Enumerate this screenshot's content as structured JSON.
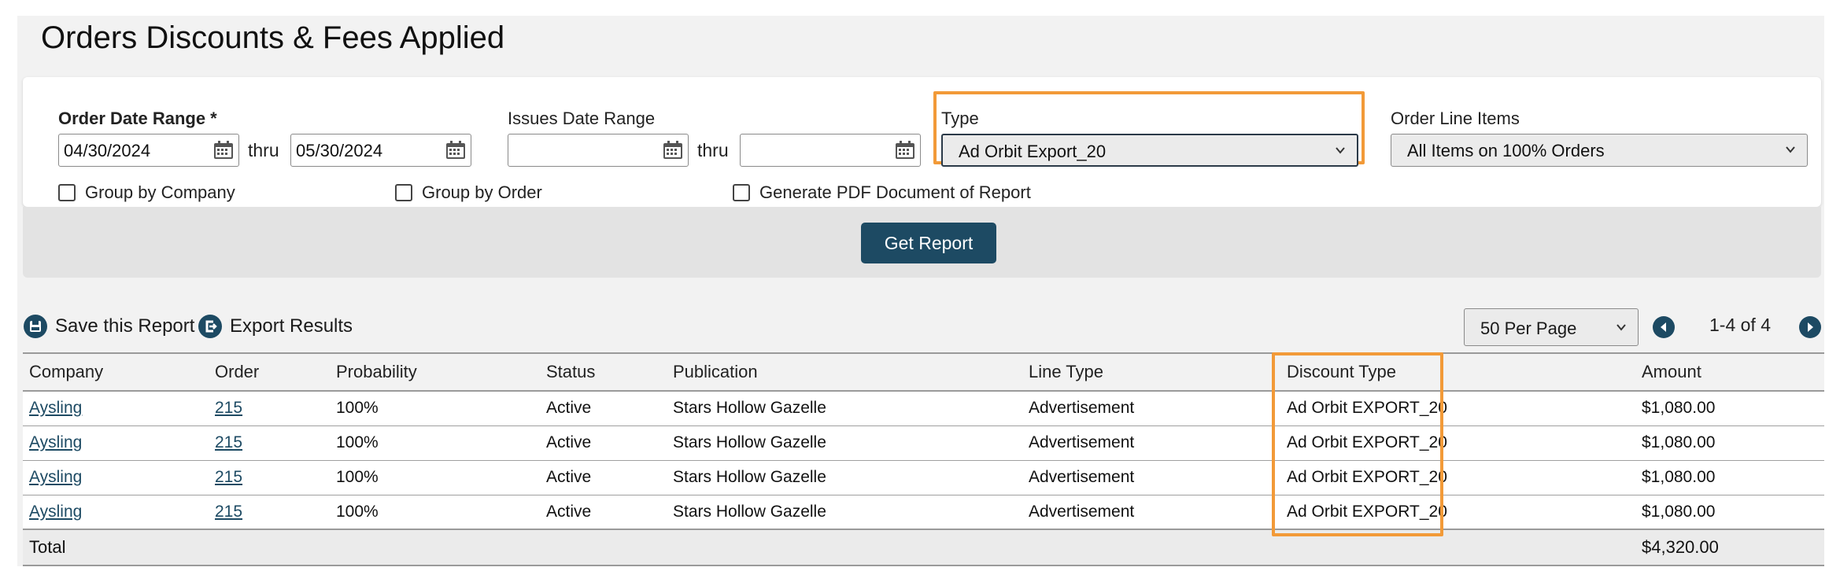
{
  "page": {
    "title": "Orders Discounts & Fees Applied"
  },
  "filters": {
    "order_date_label": "Order Date Range *",
    "order_date_from": "04/30/2024",
    "order_date_to": "05/30/2024",
    "thru_label": "thru",
    "issues_date_label": "Issues Date Range",
    "issues_date_from": "",
    "issues_date_to": "",
    "type_label": "Type",
    "type_value": "Ad Orbit Export_20",
    "line_items_label": "Order Line Items",
    "line_items_value": "All Items on 100% Orders",
    "group_company_label": "Group by Company",
    "group_order_label": "Group by Order",
    "pdf_label": "Generate PDF Document of Report",
    "get_report_label": "Get Report"
  },
  "toolbar": {
    "save_label": "Save this Report",
    "export_label": "Export Results",
    "per_page_value": "50 Per Page",
    "pager_text": "1-4 of 4"
  },
  "table": {
    "headers": [
      "Company",
      "Order",
      "Probability",
      "Status",
      "Publication",
      "Line Type",
      "Discount Type",
      "Amount"
    ],
    "rows": [
      [
        "Aysling",
        "215",
        "100%",
        "Active",
        "Stars Hollow Gazelle",
        "Advertisement",
        "Ad Orbit EXPORT_20",
        "$1,080.00"
      ],
      [
        "Aysling",
        "215",
        "100%",
        "Active",
        "Stars Hollow Gazelle",
        "Advertisement",
        "Ad Orbit EXPORT_20",
        "$1,080.00"
      ],
      [
        "Aysling",
        "215",
        "100%",
        "Active",
        "Stars Hollow Gazelle",
        "Advertisement",
        "Ad Orbit EXPORT_20",
        "$1,080.00"
      ],
      [
        "Aysling",
        "215",
        "100%",
        "Active",
        "Stars Hollow Gazelle",
        "Advertisement",
        "Ad Orbit EXPORT_20",
        "$1,080.00"
      ]
    ],
    "total_label": "Total",
    "total_amount": "$4,320.00"
  },
  "colors": {
    "accent": "#1d4a63",
    "highlight": "#f29a38",
    "panel": "#f2f2f2"
  }
}
